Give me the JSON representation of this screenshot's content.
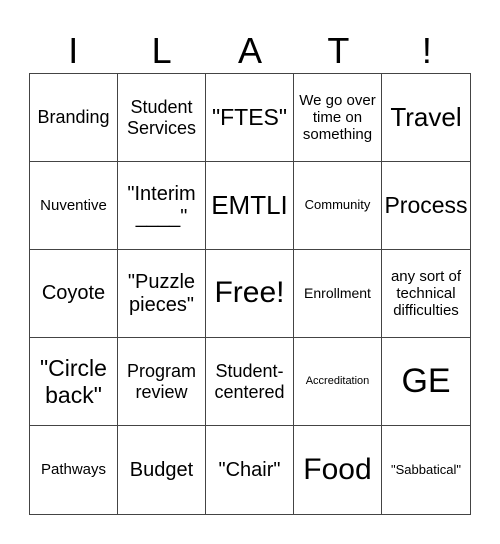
{
  "header": {
    "letters": [
      "I",
      "L",
      "A",
      "T",
      "!"
    ]
  },
  "cells": [
    "Branding",
    "Student Services",
    "\"FTES\"",
    "We go over time on something",
    "Travel",
    "Nuventive",
    "\"Interim ____\"",
    "EMTLI",
    "Community",
    "Process",
    "Coyote",
    "\"Puzzle pieces\"",
    "Free!",
    "Enrollment",
    "any sort of technical difficulties",
    "\"Circle back\"",
    "Program review",
    "Student-centered",
    "Accreditation",
    "GE",
    "Pathways",
    "Budget",
    "\"Chair\"",
    "Food",
    "\"Sabbatical\""
  ]
}
